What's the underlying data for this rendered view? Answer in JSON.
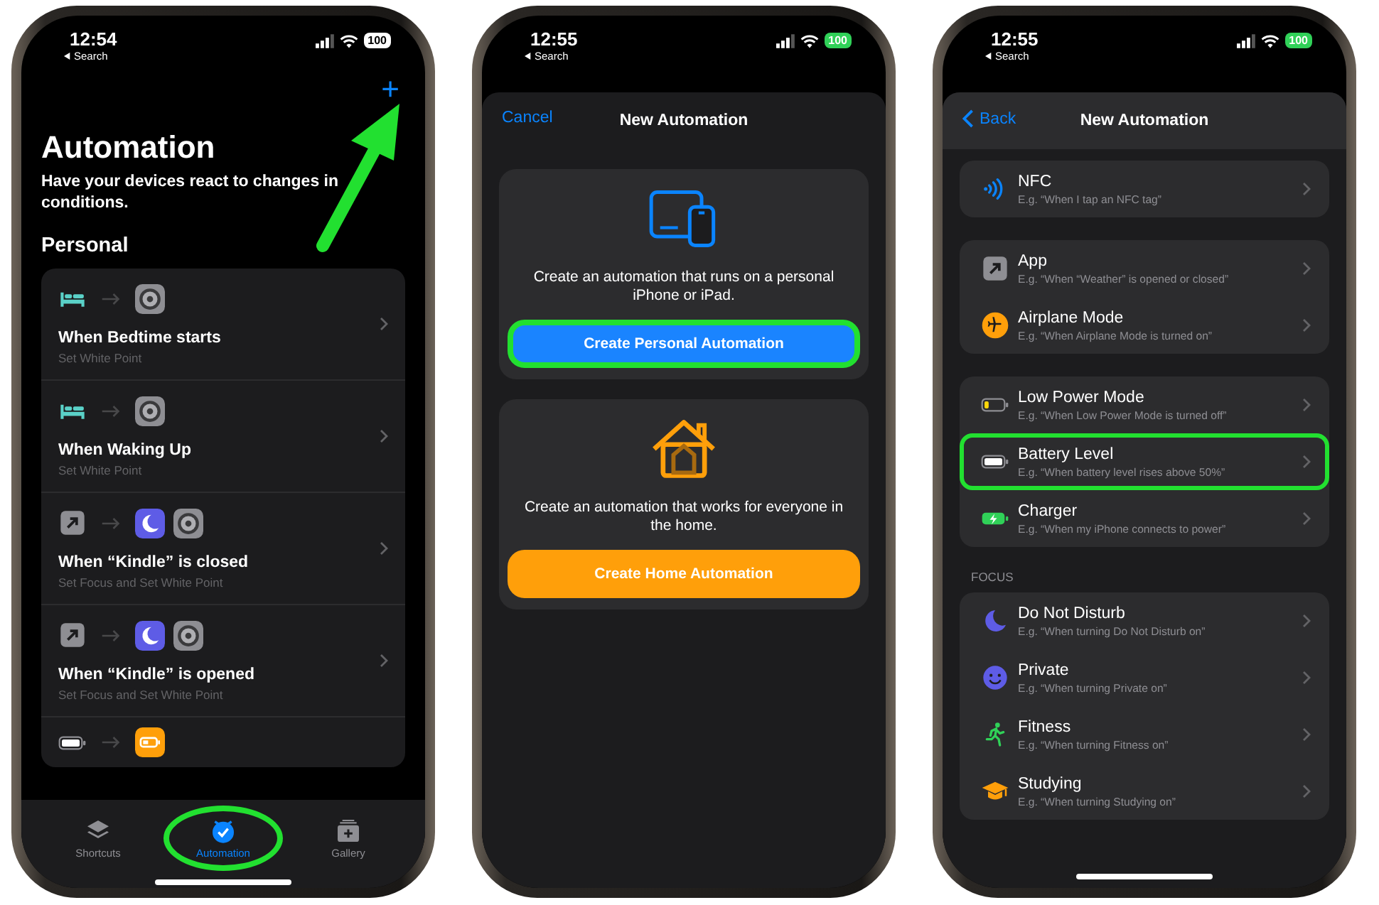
{
  "phones": [
    {
      "kind": "automations",
      "status": {
        "time": "12:54",
        "back_label": "Search",
        "battery": "100",
        "charging": false
      },
      "add_button": {
        "label": "+",
        "highlighted": true
      },
      "title": "Automation",
      "subtitle": "Have your devices react to changes in conditions.",
      "section": "Personal",
      "automations": [
        {
          "trigger": {
            "kind": "bed"
          },
          "actions": [
            {
              "kind": "settings"
            }
          ],
          "title": "When Bedtime starts",
          "detail": "Set White Point"
        },
        {
          "trigger": {
            "kind": "bed"
          },
          "actions": [
            {
              "kind": "settings"
            }
          ],
          "title": "When Waking Up",
          "detail": "Set White Point"
        },
        {
          "trigger": {
            "kind": "app"
          },
          "actions": [
            {
              "kind": "focus"
            },
            {
              "kind": "settings"
            }
          ],
          "title": "When “Kindle” is closed",
          "detail": "Set Focus and Set White Point"
        },
        {
          "trigger": {
            "kind": "app"
          },
          "actions": [
            {
              "kind": "focus"
            },
            {
              "kind": "settings"
            }
          ],
          "title": "When “Kindle” is opened",
          "detail": "Set Focus and Set White Point"
        },
        {
          "trigger": {
            "kind": "battery"
          },
          "actions": [
            {
              "kind": "low-power"
            }
          ]
        }
      ],
      "tabs": [
        {
          "kind": "layers",
          "label": "Shortcuts",
          "selected": false,
          "highlighted": false
        },
        {
          "kind": "automation",
          "label": "Automation",
          "selected": true,
          "highlighted": true
        },
        {
          "kind": "gallery",
          "label": "Gallery",
          "selected": false,
          "highlighted": false
        }
      ]
    },
    {
      "kind": "new-automation",
      "status": {
        "time": "12:55",
        "back_label": "Search",
        "battery": "100",
        "charging": true
      },
      "cancel": "Cancel",
      "title": "New Automation",
      "options": [
        {
          "kind": "devices",
          "text": "Create an automation that runs on a personal iPhone or iPad.",
          "button": "Create Personal Automation",
          "color": "#1a84ff",
          "highlighted": true
        },
        {
          "kind": "home",
          "text": "Create an automation that works for everyone in the home.",
          "button": "Create Home Automation",
          "color": "#ff9f0a",
          "highlighted": false
        }
      ]
    },
    {
      "kind": "triggers",
      "status": {
        "time": "12:55",
        "back_label": "Search",
        "battery": "100",
        "charging": true
      },
      "back": "Back",
      "title": "New Automation",
      "groups": [
        {
          "rows": [
            {
              "kind": "nfc",
              "title": "NFC",
              "example": "E.g. “When I tap an NFC tag”",
              "highlighted": false
            }
          ]
        },
        {
          "rows": [
            {
              "kind": "app",
              "title": "App",
              "example": "E.g. “When “Weather” is opened or closed”",
              "highlighted": false
            },
            {
              "kind": "airplane",
              "title": "Airplane Mode",
              "example": "E.g. “When Airplane Mode is turned on”",
              "highlighted": false
            }
          ]
        },
        {
          "rows": [
            {
              "kind": "battery-low",
              "title": "Low Power Mode",
              "example": "E.g. “When Low Power Mode is turned off”",
              "highlighted": false
            },
            {
              "kind": "battery",
              "title": "Battery Level",
              "example": "E.g. “When battery level rises above 50%”",
              "highlighted": true
            },
            {
              "kind": "charger",
              "title": "Charger",
              "example": "E.g. “When my iPhone connects to power”",
              "highlighted": false
            }
          ]
        },
        {
          "header": "FOCUS",
          "rows": [
            {
              "kind": "moon",
              "title": "Do Not Disturb",
              "example": "E.g. “When turning Do Not Disturb on”",
              "highlighted": false
            },
            {
              "kind": "smiley",
              "title": "Private",
              "example": "E.g. “When turning Private on”",
              "highlighted": false
            },
            {
              "kind": "runner",
              "title": "Fitness",
              "example": "E.g. “When turning Fitness on”",
              "highlighted": false
            },
            {
              "kind": "cap",
              "title": "Studying",
              "example": "E.g. “When turning Studying on”",
              "highlighted": false
            }
          ]
        }
      ]
    }
  ]
}
